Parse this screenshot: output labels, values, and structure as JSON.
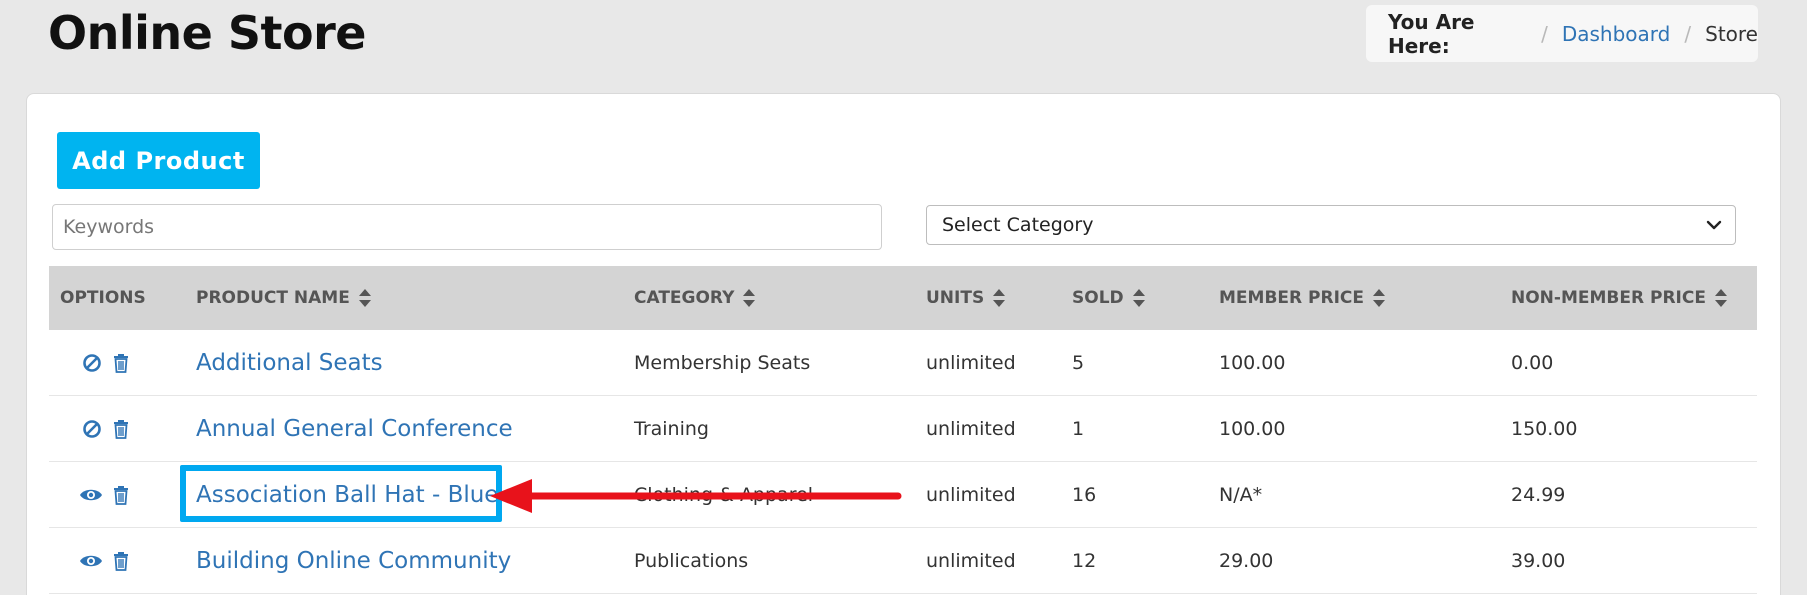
{
  "page": {
    "title": "Online Store"
  },
  "breadcrumb": {
    "label": "You Are Here:",
    "separator": "/",
    "link": "Dashboard",
    "current": "Store"
  },
  "toolbar": {
    "add_label": "Add Product"
  },
  "filters": {
    "keywords_placeholder": "Keywords",
    "category_selected": "Select Category"
  },
  "table": {
    "headers": [
      "OPTIONS",
      "PRODUCT NAME",
      "CATEGORY",
      "UNITS",
      "SOLD",
      "MEMBER PRICE",
      "NON-MEMBER PRICE"
    ],
    "rows": [
      {
        "status_icon": "disabled-icon",
        "name": "Additional Seats",
        "category": "Membership Seats",
        "units": "unlimited",
        "sold": "5",
        "member_price": "100.00",
        "non_member_price": "0.00"
      },
      {
        "status_icon": "disabled-icon",
        "name": "Annual General Conference",
        "category": "Training",
        "units": "unlimited",
        "sold": "1",
        "member_price": "100.00",
        "non_member_price": "150.00"
      },
      {
        "status_icon": "eye-icon",
        "name": "Association Ball Hat - Blue",
        "category": "Clothing & Apparel",
        "units": "unlimited",
        "sold": "16",
        "member_price": "N/A*",
        "non_member_price": "24.99"
      },
      {
        "status_icon": "eye-icon",
        "name": "Building Online Community",
        "category": "Publications",
        "units": "unlimited",
        "sold": "12",
        "member_price": "29.00",
        "non_member_price": "39.00"
      }
    ]
  },
  "colors": {
    "accent": "#00b4f0",
    "link": "#2f74b5",
    "annotation_arrow": "#e8121b",
    "annotation_box": "#00a8f0"
  }
}
